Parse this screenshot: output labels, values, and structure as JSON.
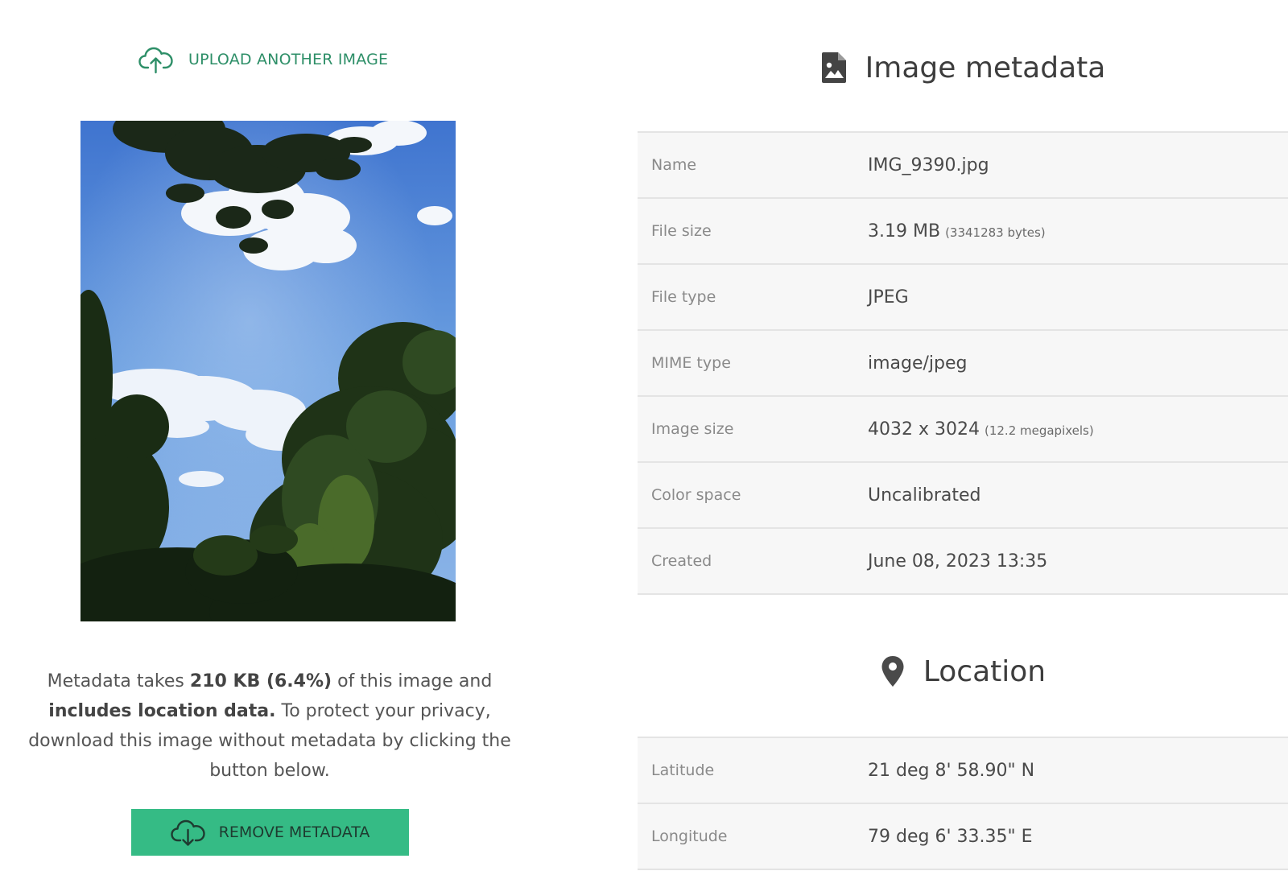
{
  "upload": {
    "label": "UPLOAD ANOTHER IMAGE",
    "icon": "cloud-upload-icon"
  },
  "preview": {
    "description_icon": "photo-sky-trees"
  },
  "privacy_notice": {
    "part1": "Metadata takes ",
    "size_highlight": "210 KB (6.4%)",
    "part2": " of this image and ",
    "location_highlight": "includes location data.",
    "part3": " To protect your privacy, download this image without metadata by clicking the button below."
  },
  "remove_button": {
    "label": "REMOVE METADATA",
    "icon": "cloud-download-icon"
  },
  "metadata_section": {
    "title": "Image metadata",
    "icon": "file-image-icon",
    "rows": [
      {
        "key": "Name",
        "value": "IMG_9390.jpg",
        "sub": ""
      },
      {
        "key": "File size",
        "value": "3.19 MB",
        "sub": "(3341283 bytes)"
      },
      {
        "key": "File type",
        "value": "JPEG",
        "sub": ""
      },
      {
        "key": "MIME type",
        "value": "image/jpeg",
        "sub": ""
      },
      {
        "key": "Image size",
        "value": "4032 x 3024",
        "sub": "(12.2 megapixels)"
      },
      {
        "key": "Color space",
        "value": "Uncalibrated",
        "sub": ""
      },
      {
        "key": "Created",
        "value": "June 08, 2023 13:35",
        "sub": ""
      }
    ]
  },
  "location_section": {
    "title": "Location",
    "icon": "map-pin-icon",
    "rows": [
      {
        "key": "Latitude",
        "value": "21 deg 8' 58.90\" N"
      },
      {
        "key": "Longitude",
        "value": "79 deg 6' 33.35\" E"
      }
    ]
  },
  "colors": {
    "accent": "#2e8f68",
    "button": "#35bb85",
    "row_bg": "#f7f7f7",
    "row_border": "#e4e4e4"
  }
}
